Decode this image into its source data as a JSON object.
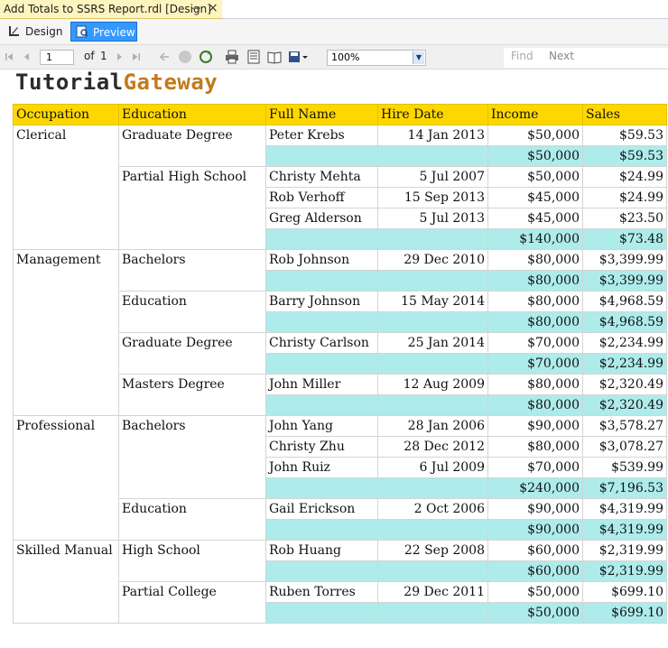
{
  "document_tab": {
    "title": "Add Totals to SSRS Report.rdl [Design]",
    "pin_glyph": "⊸",
    "close_glyph": "×"
  },
  "view_tabs": {
    "design_label": "Design",
    "preview_label": "Preview"
  },
  "toolbar": {
    "page_value": "1",
    "of_label": "of",
    "total_pages": "1",
    "zoom_value": "100%",
    "find_label": "Find",
    "next_label": "Next",
    "icons": [
      "first-page-icon",
      "previous-page-icon",
      "next-page-icon",
      "last-page-icon",
      "back-icon",
      "stop-icon",
      "refresh-icon",
      "print-icon",
      "print-layout-icon",
      "page-setup-icon",
      "export-icon"
    ]
  },
  "logo": {
    "part1": "Tutorial",
    "part2": "Gateway"
  },
  "colors": {
    "header_bg": "#ffd700",
    "total_bg": "#aeebeb",
    "preview_tab": "#3399ff",
    "doc_tab": "#fdf4bf",
    "logo_accent": "#c27a1b"
  },
  "report": {
    "columns": [
      "Occupation",
      "Education",
      "Full Name",
      "Hire Date",
      "Income",
      "Sales"
    ],
    "groups": [
      {
        "occupation": "Clerical",
        "subgroups": [
          {
            "education": "Graduate Degree",
            "rows": [
              {
                "name": "Peter Krebs",
                "hire": "14 Jan 2013",
                "income": "$50,000",
                "sales": "$59.53"
              }
            ],
            "total_income": "$50,000",
            "total_sales": "$59.53"
          },
          {
            "education": "Partial High School",
            "rows": [
              {
                "name": "Christy Mehta",
                "hire": "5 Jul 2007",
                "income": "$50,000",
                "sales": "$24.99"
              },
              {
                "name": "Rob Verhoff",
                "hire": "15 Sep 2013",
                "income": "$45,000",
                "sales": "$24.99"
              },
              {
                "name": "Greg Alderson",
                "hire": "5 Jul 2013",
                "income": "$45,000",
                "sales": "$23.50"
              }
            ],
            "total_income": "$140,000",
            "total_sales": "$73.48"
          }
        ]
      },
      {
        "occupation": "Management",
        "subgroups": [
          {
            "education": "Bachelors",
            "rows": [
              {
                "name": "Rob Johnson",
                "hire": "29 Dec 2010",
                "income": "$80,000",
                "sales": "$3,399.99"
              }
            ],
            "total_income": "$80,000",
            "total_sales": "$3,399.99"
          },
          {
            "education": "Education",
            "rows": [
              {
                "name": "Barry Johnson",
                "hire": "15 May 2014",
                "income": "$80,000",
                "sales": "$4,968.59"
              }
            ],
            "total_income": "$80,000",
            "total_sales": "$4,968.59"
          },
          {
            "education": "Graduate Degree",
            "rows": [
              {
                "name": "Christy Carlson",
                "hire": "25 Jan 2014",
                "income": "$70,000",
                "sales": "$2,234.99"
              }
            ],
            "total_income": "$70,000",
            "total_sales": "$2,234.99"
          },
          {
            "education": "Masters Degree",
            "rows": [
              {
                "name": "John Miller",
                "hire": "12 Aug 2009",
                "income": "$80,000",
                "sales": "$2,320.49"
              }
            ],
            "total_income": "$80,000",
            "total_sales": "$2,320.49"
          }
        ]
      },
      {
        "occupation": "Professional",
        "subgroups": [
          {
            "education": "Bachelors",
            "rows": [
              {
                "name": "John Yang",
                "hire": "28 Jan 2006",
                "income": "$90,000",
                "sales": "$3,578.27"
              },
              {
                "name": "Christy Zhu",
                "hire": "28 Dec 2012",
                "income": "$80,000",
                "sales": "$3,078.27"
              },
              {
                "name": "John Ruiz",
                "hire": "6 Jul 2009",
                "income": "$70,000",
                "sales": "$539.99"
              }
            ],
            "total_income": "$240,000",
            "total_sales": "$7,196.53"
          },
          {
            "education": "Education",
            "rows": [
              {
                "name": "Gail Erickson",
                "hire": "2 Oct 2006",
                "income": "$90,000",
                "sales": "$4,319.99"
              }
            ],
            "total_income": "$90,000",
            "total_sales": "$4,319.99"
          }
        ]
      },
      {
        "occupation": "Skilled Manual",
        "subgroups": [
          {
            "education": "High School",
            "rows": [
              {
                "name": "Rob Huang",
                "hire": "22 Sep 2008",
                "income": "$60,000",
                "sales": "$2,319.99"
              }
            ],
            "total_income": "$60,000",
            "total_sales": "$2,319.99"
          },
          {
            "education": "Partial College",
            "rows": [
              {
                "name": "Ruben Torres",
                "hire": "29 Dec 2011",
                "income": "$50,000",
                "sales": "$699.10"
              }
            ],
            "total_income": "$50,000",
            "total_sales": "$699.10"
          }
        ]
      }
    ]
  }
}
